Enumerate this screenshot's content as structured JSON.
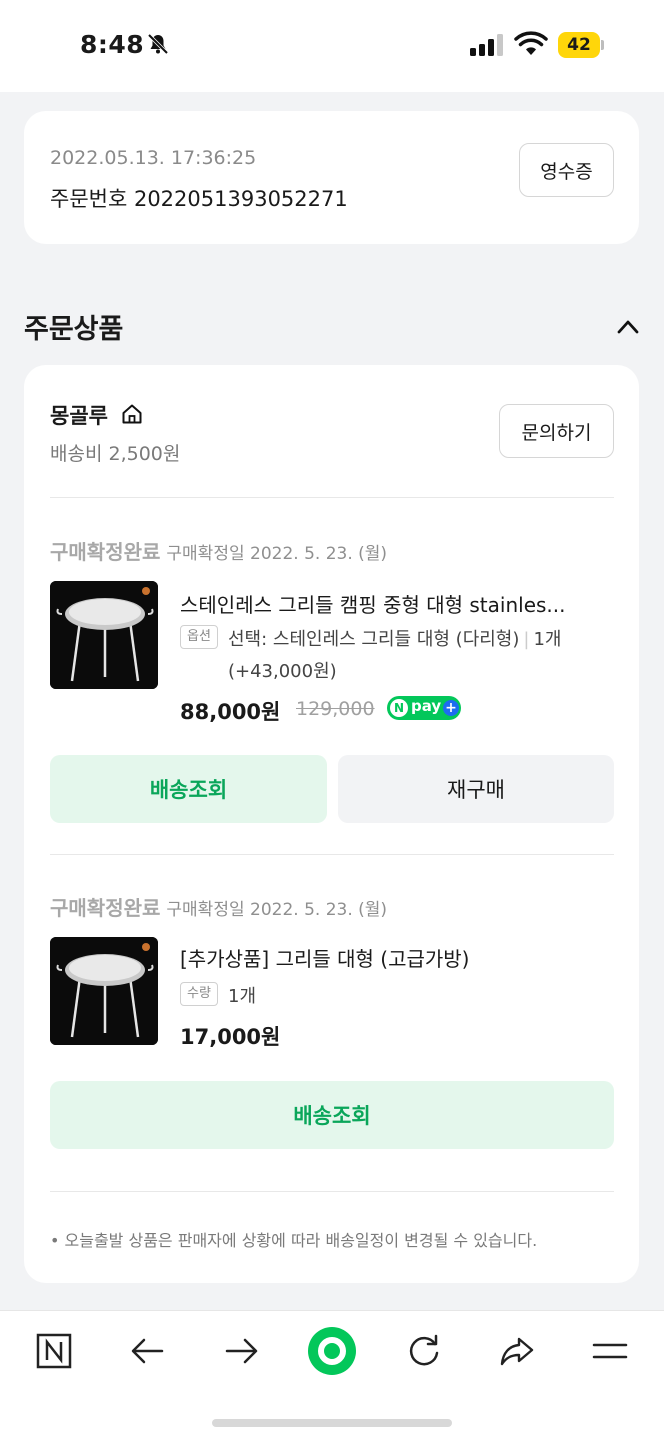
{
  "status_bar": {
    "time": "8:48",
    "battery": "42"
  },
  "order": {
    "datetime": "2022.05.13. 17:36:25",
    "number_label": "주문번호 2022051393052271",
    "receipt_button": "영수증"
  },
  "section": {
    "title": "주문상품"
  },
  "seller": {
    "name": "몽골루",
    "shipping_fee": "배송비 2,500원",
    "inquiry_button": "문의하기"
  },
  "items": [
    {
      "status": "구매확정완료",
      "confirm_date": "구매확정일 2022. 5. 23. (월)",
      "title": "스테인레스 그리들 캠핑 중형 대형 stainles...",
      "tag": "옵션",
      "option": "선택: 스테인레스 그리들 대형 (다리형)",
      "quantity": "1개",
      "option_price": "(+43,000원)",
      "price": "88,000원",
      "original_price": "129,000",
      "npay_label": "pay",
      "track_button": "배송조회",
      "rebuy_button": "재구매"
    },
    {
      "status": "구매확정완료",
      "confirm_date": "구매확정일 2022. 5. 23. (월)",
      "title": "[추가상품] 그리들 대형 (고급가방)",
      "tag": "수량",
      "quantity": "1개",
      "price": "17,000원",
      "track_button": "배송조회"
    }
  ],
  "notice": "• 오늘출발 상품은 판매자에 상황에 따라 배송일정이 변경될 수 있습니다.",
  "bottom_nav": {
    "icons": [
      "naver-n-icon",
      "back-arrow-icon",
      "forward-arrow-icon",
      "green-home-icon",
      "refresh-icon",
      "share-icon",
      "menu-icon"
    ]
  },
  "colors": {
    "accent_green": "#03c75a",
    "button_green_bg": "#e4f7ec",
    "button_green_text": "#0aa65a",
    "background": "#f2f3f5"
  }
}
